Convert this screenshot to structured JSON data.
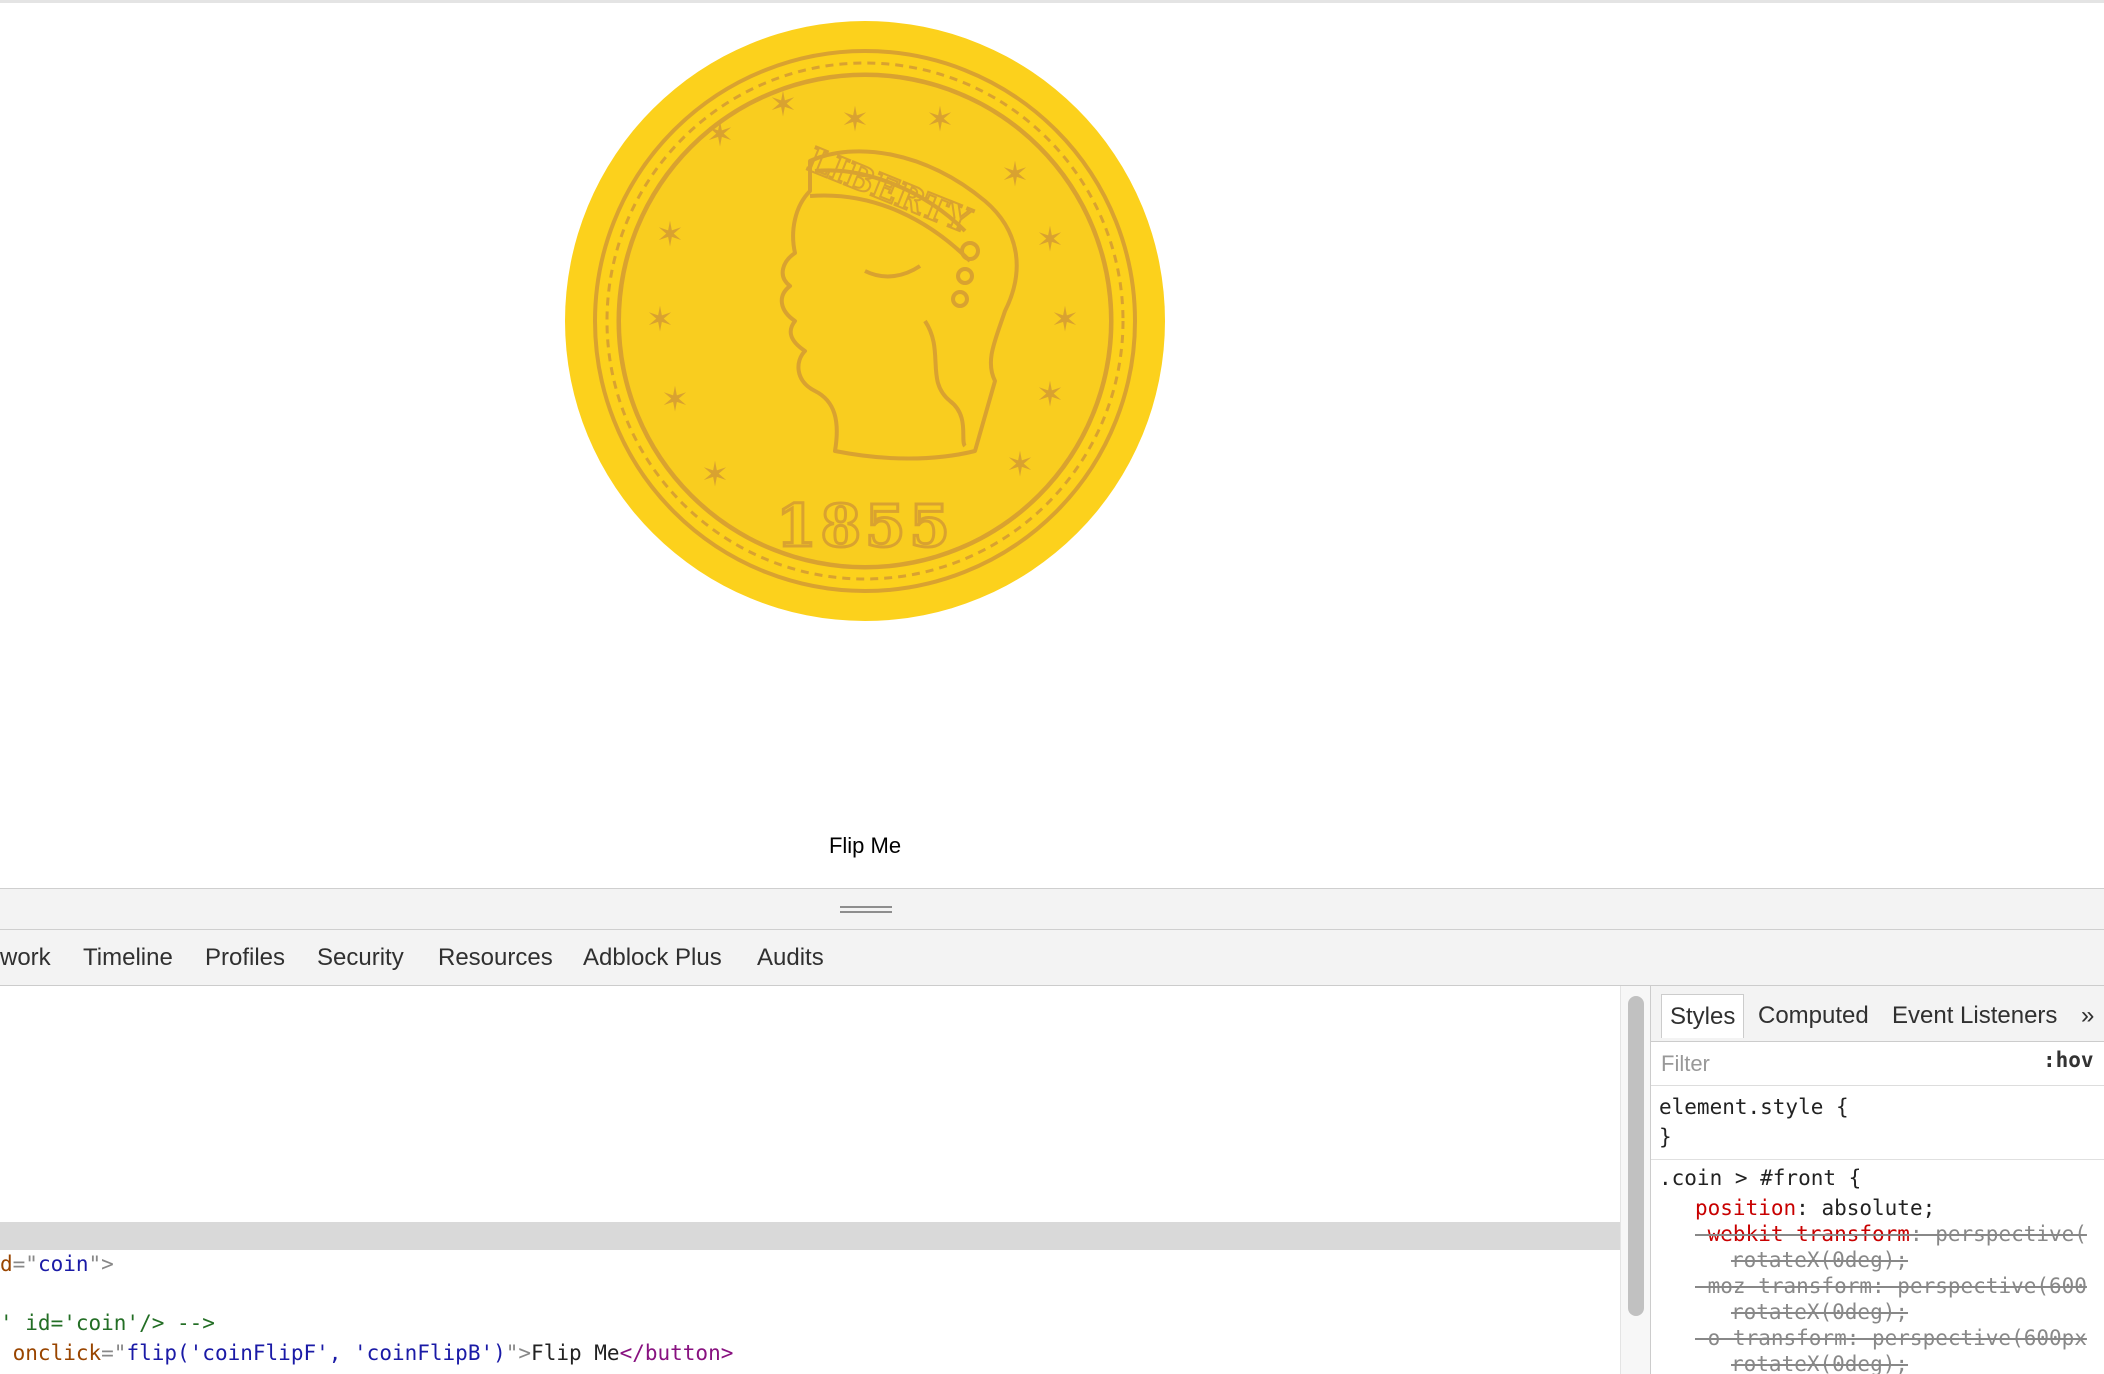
{
  "page": {
    "flip_button_label": "Flip Me",
    "coin": {
      "year": "1855",
      "inscription": "LIBERTY",
      "colors": {
        "rim": "#fcd11c",
        "face": "#f9cd1f",
        "engraving": "#d9a230"
      }
    }
  },
  "devtools": {
    "tabs": [
      "work",
      "Timeline",
      "Profiles",
      "Security",
      "Resources",
      "Adblock Plus",
      "Audits"
    ],
    "elements": {
      "line1": {
        "attr_prefix": "d",
        "eq": "=\"",
        "value": "coin",
        "close": "\">"
      },
      "line2": {
        "comment": "' id='coin'/> -->"
      },
      "line3": {
        "attr_name": " onclick",
        "eq": "=\"",
        "value": "flip('coinFlipF', 'coinFlipB')",
        "close": "\">",
        "text": "Flip Me",
        "end_tag": "</button>"
      }
    },
    "sidebar": {
      "tabs": [
        "Styles",
        "Computed",
        "Event Listeners"
      ],
      "more": "»",
      "filter_placeholder": "Filter",
      "hov": ":hov",
      "element_style_open": "element.style {",
      "element_style_close": "}",
      "selector": ".coin > #front {",
      "props": [
        {
          "name": "position",
          "value": ": absolute;"
        },
        {
          "name": "-webkit-transform",
          "value": ": perspective("
        },
        {
          "continuation": "rotateX(0deg);"
        },
        {
          "name": "-moz-transform",
          "value": ": perspective(600"
        },
        {
          "continuation": "rotateX(0deg);"
        },
        {
          "name": "-o-transform",
          "value": ": perspective(600px"
        },
        {
          "continuation": "rotateX(0deg);"
        }
      ]
    }
  }
}
